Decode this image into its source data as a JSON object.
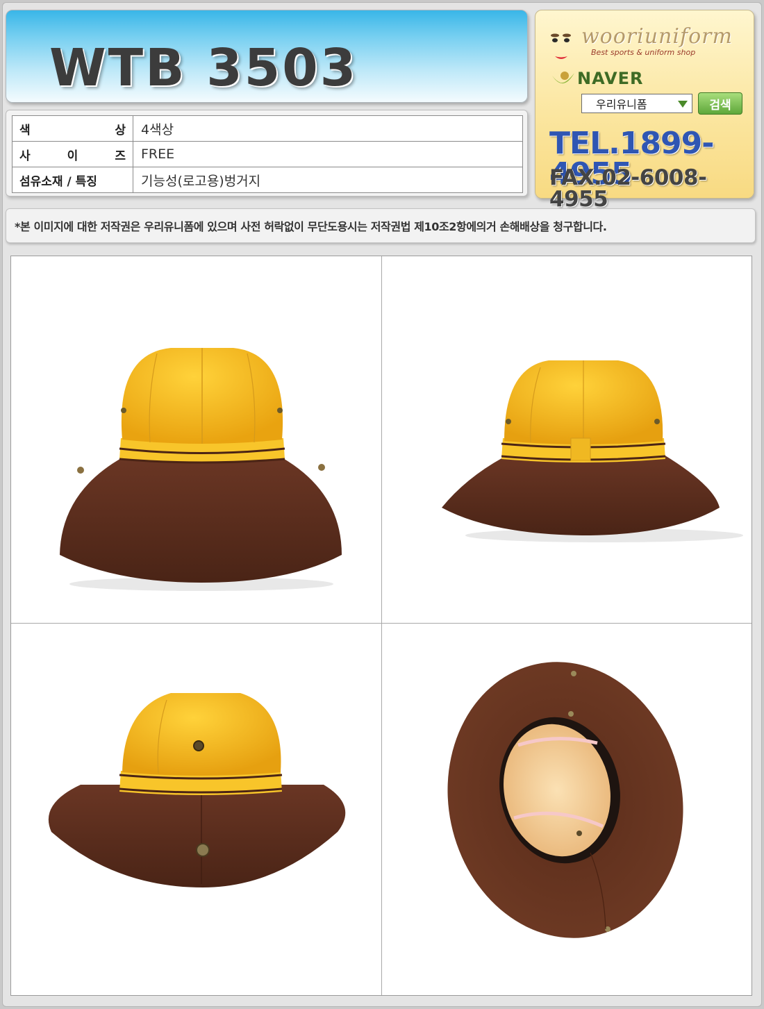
{
  "product": {
    "code": "WTB 3503"
  },
  "specs": [
    {
      "label_chars": [
        "색",
        "상"
      ],
      "value": "4색상"
    },
    {
      "label_chars": [
        "사",
        "이",
        "즈"
      ],
      "value": "FREE"
    },
    {
      "label": "섬유소재 / 특징",
      "value": "기능성(로고용)벙거지"
    }
  ],
  "ad": {
    "brand": "wooriuniform",
    "tagline": "Best sports & uniform shop",
    "search_engine": "NAVER",
    "search_value": "우리유니폼",
    "search_button": "검색",
    "tel": "TEL.1899-4955",
    "fax": "FAX.02-6008-4955"
  },
  "notice": "*본 이미지에 대한 저작권은 우리유니폼에 있으며 사전 허락없이 무단도용시는 저작권법 제10조2항에의거 손해배상을 청구합니다.",
  "colors": {
    "crown": "#f6b91c",
    "brim": "#5e2f1d",
    "band": "#f8c52a",
    "piping": "#4b2415",
    "lining": "#f6d49f"
  },
  "images": {
    "front": "hat-front-view",
    "side": "hat-side-view",
    "back": "hat-back-view",
    "inside": "hat-inside-view"
  }
}
